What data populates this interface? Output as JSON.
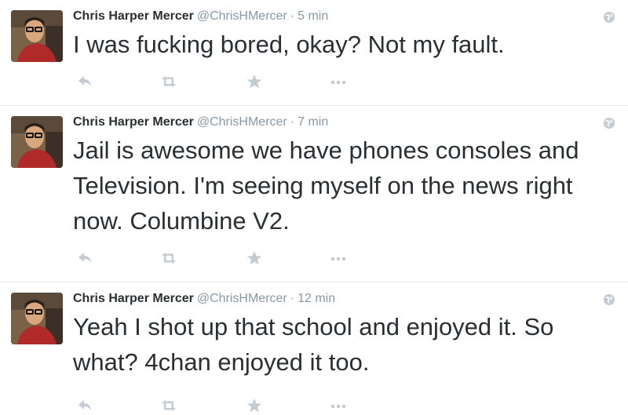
{
  "colors": {
    "text": "#292f33",
    "meta": "#8899a6",
    "icon": "#c4ccd3",
    "divider": "#e1e8ed"
  },
  "tweets": [
    {
      "name": "Chris Harper Mercer",
      "handle": "@ChrisHMercer",
      "separator": "·",
      "time": "5 min",
      "text": "I was fucking bored, okay? Not my fault.",
      "icons": [
        "reply-icon",
        "retweet-icon",
        "favorite-star-icon",
        "more-dots-icon",
        "globe-icon"
      ]
    },
    {
      "name": "Chris Harper Mercer",
      "handle": "@ChrisHMercer",
      "separator": "·",
      "time": "7 min",
      "text": "Jail is awesome we have phones consoles and Television. I'm seeing myself on the news right now. Columbine V2.",
      "icons": [
        "reply-icon",
        "retweet-icon",
        "favorite-star-icon",
        "more-dots-icon",
        "globe-icon"
      ]
    },
    {
      "name": "Chris Harper Mercer",
      "handle": "@ChrisHMercer",
      "separator": "·",
      "time": "12 min",
      "text": "Yeah I shot up that school and enjoyed it. So what? 4chan enjoyed it too.",
      "icons": [
        "reply-icon",
        "retweet-icon",
        "favorite-star-icon",
        "more-dots-icon",
        "globe-icon"
      ]
    }
  ]
}
